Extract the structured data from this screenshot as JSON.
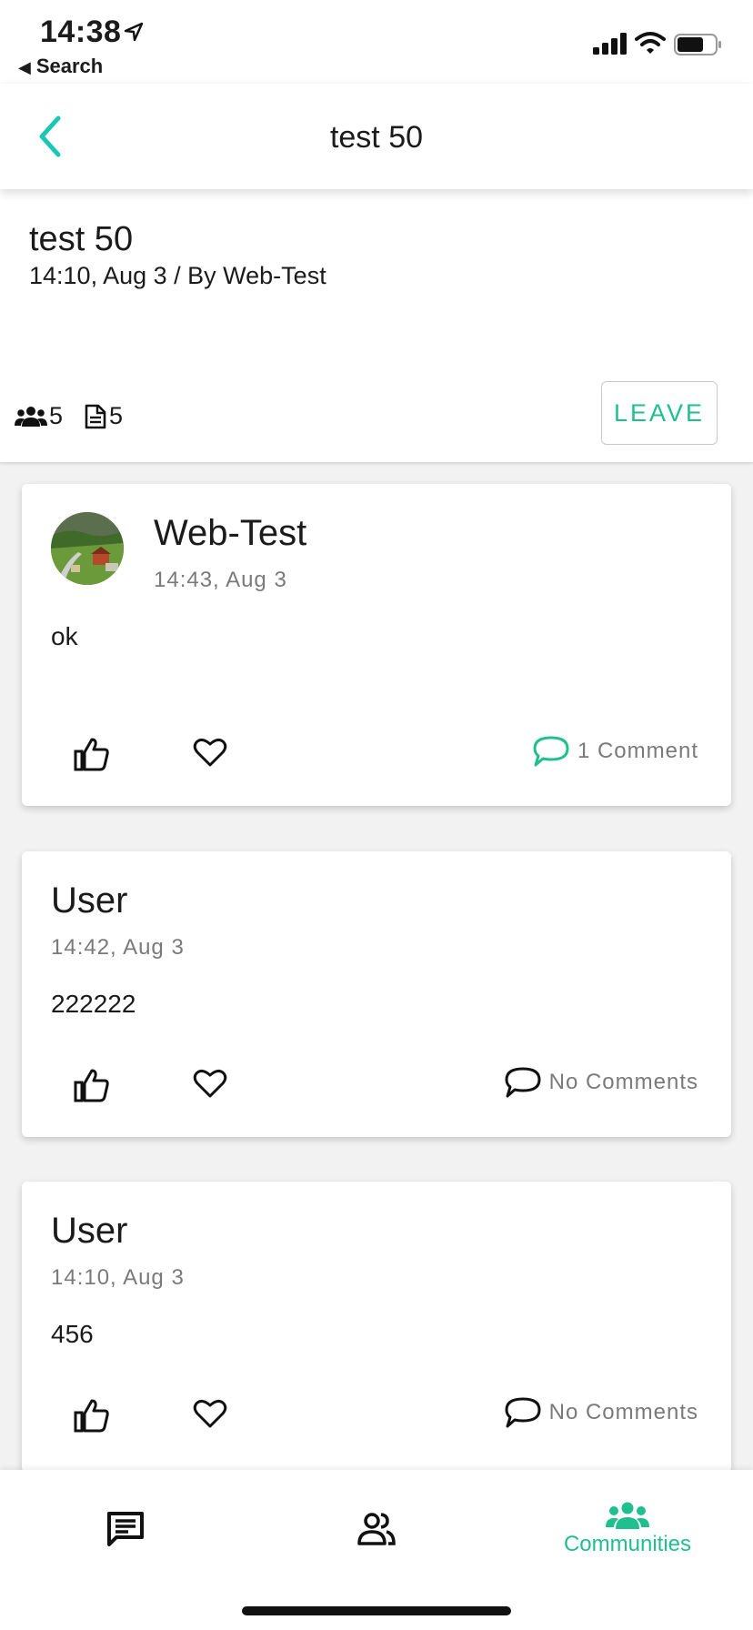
{
  "status_bar": {
    "time": "14:38",
    "back_label": "Search",
    "icons": [
      "location-arrow-icon",
      "cellular-signal-icon",
      "wifi-icon",
      "battery-icon"
    ]
  },
  "nav": {
    "title": "test 50",
    "back_icon": "chevron-left-icon"
  },
  "community": {
    "title": "test 50",
    "meta": "14:10, Aug 3 / By Web-Test",
    "members_count": "5",
    "posts_count": "5",
    "leave_label": "LEAVE"
  },
  "posts": [
    {
      "author": "Web-Test",
      "date": "14:43, Aug 3",
      "body": "ok",
      "comments_label": "1 Comment",
      "has_avatar": true
    },
    {
      "author": "User",
      "date": "14:42, Aug 3",
      "body": "222222",
      "comments_label": "No Comments",
      "has_avatar": false
    },
    {
      "author": "User",
      "date": "14:10, Aug 3",
      "body": "456",
      "comments_label": "No Comments",
      "has_avatar": false
    }
  ],
  "tabbar": {
    "tabs": [
      {
        "icon": "chat-icon",
        "label": ""
      },
      {
        "icon": "people-icon",
        "label": ""
      },
      {
        "icon": "communities-icon",
        "label": "Communities",
        "active": true
      }
    ]
  },
  "colors": {
    "accent": "#1fbf8f",
    "back_chevron": "#19c7b4",
    "muted_text": "#7a7a7a",
    "text": "#1b1b1b"
  }
}
